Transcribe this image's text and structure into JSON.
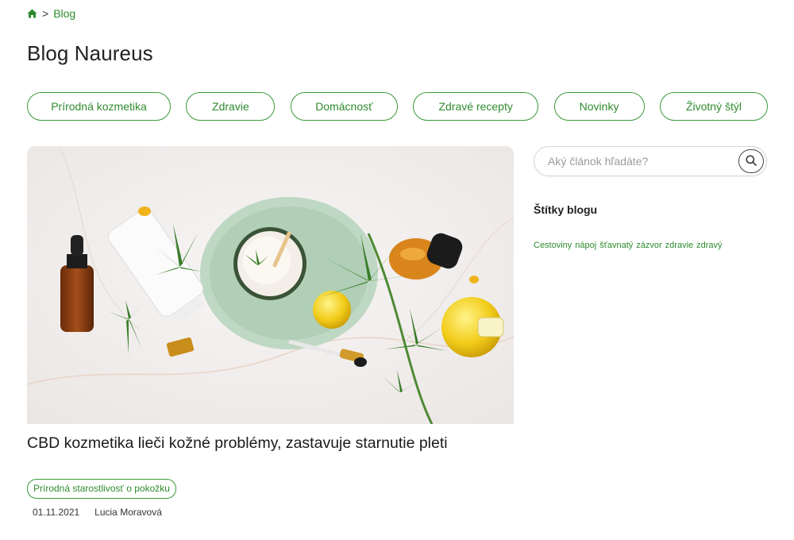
{
  "breadcrumb": {
    "home_icon": "home-icon",
    "separator": ">",
    "current": "Blog"
  },
  "page": {
    "title": "Blog Naureus"
  },
  "categories": [
    {
      "label": "Prírodná kozmetika"
    },
    {
      "label": "Zdravie"
    },
    {
      "label": "Domácnosť"
    },
    {
      "label": "Zdravé recepty"
    },
    {
      "label": "Novinky"
    },
    {
      "label": "Životný štýl"
    }
  ],
  "article": {
    "title": "CBD kozmetika lieči kožné problémy, zastavuje starnutie pleti",
    "tag": "Prírodná starostlivosť o pokožku",
    "date": "01.11.2021",
    "author": "Lucia Moravová"
  },
  "sidebar": {
    "search_placeholder": "Aký článok hľadáte?",
    "search_icon": "search-icon",
    "tags_heading": "Štítky blogu",
    "tags": [
      {
        "label": "Cestoviny"
      },
      {
        "label": "nápoj"
      },
      {
        "label": "šťavnatý"
      },
      {
        "label": "zázvor"
      },
      {
        "label": "zdravie"
      },
      {
        "label": "zdravý"
      }
    ]
  },
  "colors": {
    "accent": "#2e8b2e",
    "border": "#3a9a3a",
    "text": "#1f1f1f"
  }
}
